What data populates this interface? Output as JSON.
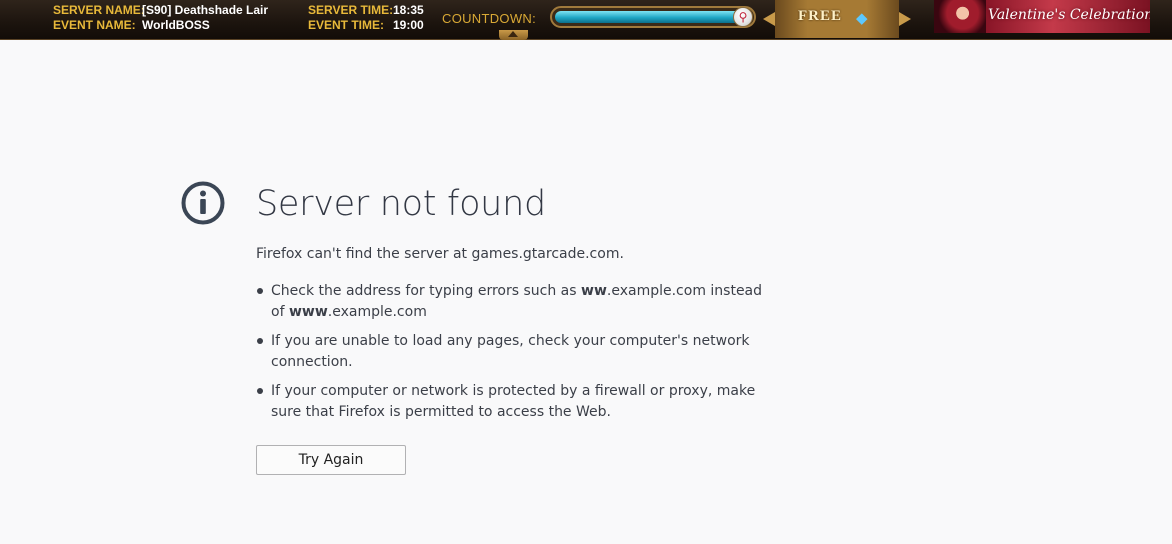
{
  "topbar": {
    "server_name_label": "SERVER NAME:",
    "server_name_value": "[S90] Deathshade Lair",
    "event_name_label": "EVENT NAME:",
    "event_name_value": "WorldBOSS",
    "server_time_label": "SERVER TIME:",
    "server_time_value": "18:35",
    "event_time_label": "EVENT TIME:",
    "event_time_value": "19:00",
    "countdown_label": "COUNTDOWN:",
    "countdown_progress": 0.98,
    "free_label": "FREE",
    "banner_text": "Valentine's Celebration",
    "icons": {
      "medal": "medal-icon",
      "gem": "diamond-gem-icon",
      "toggle": "collapse-arrow-icon"
    },
    "colors": {
      "label": "#e8b93a",
      "value": "#ffffff",
      "bar": "#1fa6c4"
    }
  },
  "error": {
    "icon": "info-icon",
    "title": "Server not found",
    "description": "Firefox can't find the server at games.gtarcade.com.",
    "tip1_a": "Check the address for typing errors such as ",
    "tip1_b": "ww",
    "tip1_c": ".example.com instead of ",
    "tip1_d": "www",
    "tip1_e": ".example.com",
    "tip2": "If you are unable to load any pages, check your computer's network connection.",
    "tip3": "If your computer or network is protected by a firewall or proxy, make sure that Firefox is permitted to access the Web.",
    "try_again_label": "Try Again",
    "colors": {
      "text": "#3b3f48",
      "title": "#333844",
      "background": "#f9f9fa"
    }
  }
}
